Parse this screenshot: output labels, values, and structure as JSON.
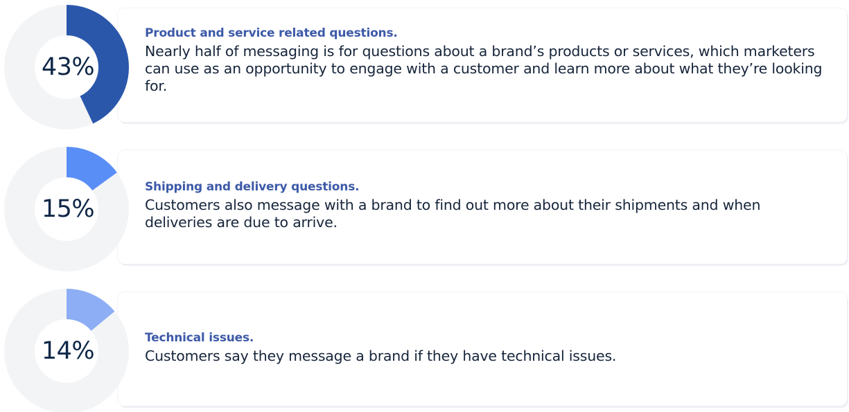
{
  "chart_data": {
    "type": "pie",
    "track_color": "#f3f4f6",
    "items": [
      {
        "value": 43,
        "label": "43%",
        "color": "#2b57ab",
        "title": "Product and service related questions.",
        "description": "Nearly half of messaging is for questions about a brand’s products or services, which marketers can use as an opportunity to engage with a customer and learn more about what they’re looking for."
      },
      {
        "value": 15,
        "label": "15%",
        "color": "#5a8ef7",
        "title": "Shipping and delivery questions.",
        "description": "Customers also message with a brand to find out more about their shipments and when deliveries are due to arrive."
      },
      {
        "value": 14,
        "label": "14%",
        "color": "#8dadf5",
        "title": "Technical issues.",
        "description": "Customers say they message a brand if they have technical issues."
      }
    ]
  }
}
